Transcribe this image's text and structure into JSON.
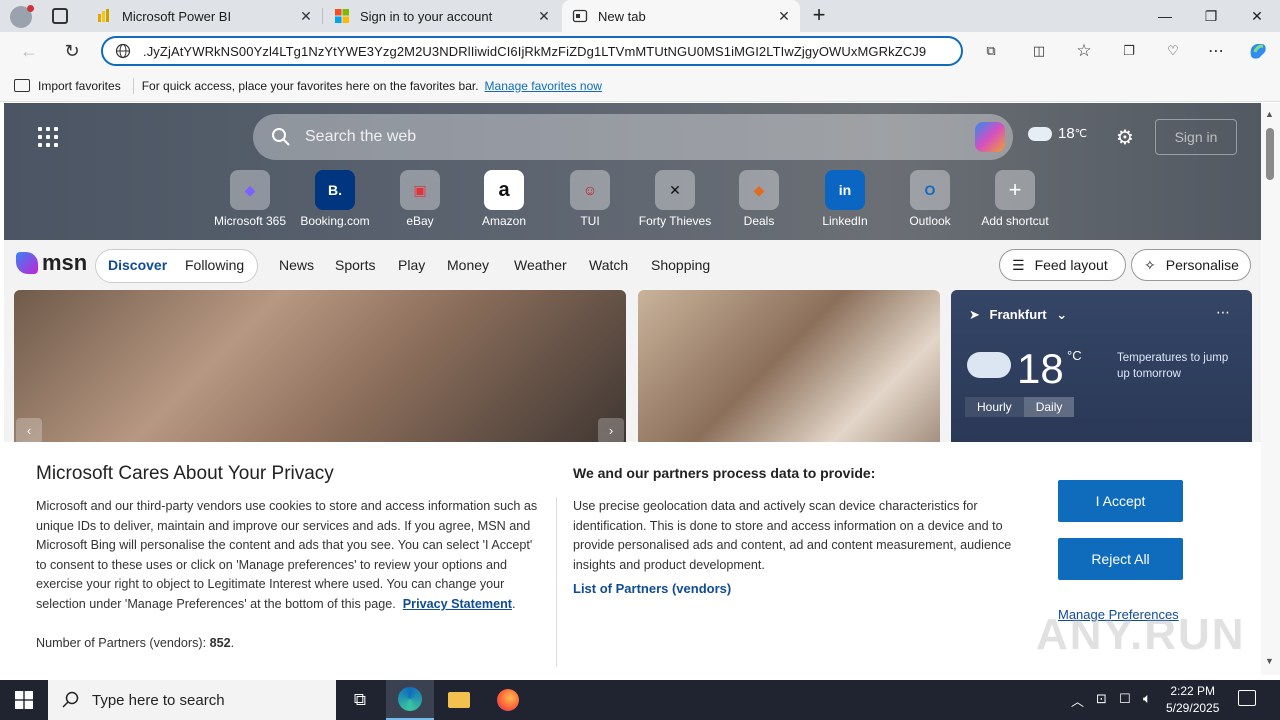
{
  "browser": {
    "tabs": [
      {
        "title": "Microsoft Power BI"
      },
      {
        "title": "Sign in to your account"
      },
      {
        "title": "New tab"
      }
    ],
    "address": ".JyZjAtYWRkNS00Yzl4LTg1NzYtYWE3Yzg2M2U3NDRlIiwidCI6IjRkMzFiZDg1LTVmMTUtNGU0MS1iMGI2LTIwZjgyOWUxMGRkZCJ9",
    "favorites_bar": {
      "import_label": "Import favorites",
      "message": "For quick access, place your favorites here on the favorites bar.",
      "manage_link": "Manage favorites now"
    }
  },
  "newtab": {
    "search_placeholder": "Search the web",
    "weather_temp": "18",
    "weather_unit": "℃",
    "signin_label": "Sign in",
    "shortcuts": [
      {
        "label": "Microsoft 365",
        "glyph": "◆"
      },
      {
        "label": "Booking.com",
        "glyph": "B."
      },
      {
        "label": "eBay",
        "glyph": "▣"
      },
      {
        "label": "Amazon",
        "glyph": "a"
      },
      {
        "label": "TUI",
        "glyph": "☺"
      },
      {
        "label": "Forty Thieves",
        "glyph": "✕"
      },
      {
        "label": "Deals",
        "glyph": "◆"
      },
      {
        "label": "LinkedIn",
        "glyph": "in"
      },
      {
        "label": "Outlook",
        "glyph": "O"
      },
      {
        "label": "Add shortcut",
        "glyph": "+"
      }
    ]
  },
  "msn": {
    "logo": "msn",
    "tabs": [
      "Discover",
      "Following"
    ],
    "nav": [
      "News",
      "Sports",
      "Play",
      "Money",
      "Weather",
      "Watch",
      "Shopping"
    ],
    "feed_layout": "Feed layout",
    "personalise": "Personalise",
    "weather_card": {
      "location": "Frankfurt",
      "temp": "18",
      "unit": "°C",
      "note": "Temperatures to jump up tomorrow",
      "toggle": [
        "Hourly",
        "Daily"
      ]
    }
  },
  "consent": {
    "title": "Microsoft Cares About Your Privacy",
    "body": "Microsoft and our third-party vendors use cookies to store and access information such as unique IDs to deliver, maintain and improve our services and ads. If you agree, MSN and Microsoft Bing will personalise the content and ads that you see. You can select 'I Accept' to consent to these uses or click on 'Manage preferences' to review your options and exercise your right to object to Legitimate Interest where used.  You can change your selection under 'Manage Preferences' at the bottom of this page.",
    "privacy_link": "Privacy Statement",
    "partners_label": "Number of Partners (vendors):",
    "partners_count": "852",
    "purpose_title": "We and our partners process data to provide:",
    "purpose_body": "Use precise geolocation data and actively scan device characteristics for identification. This is done to store and access information on a device and to provide personalised ads and content, ad and content measurement, audience insights and product development.",
    "list_partners": "List of Partners (vendors)",
    "accept": "I Accept",
    "reject": "Reject All",
    "manage": "Manage Preferences"
  },
  "taskbar": {
    "search_placeholder": "Type here to search",
    "time": "2:22 PM",
    "date": "5/29/2025"
  },
  "watermark": "ANY.RUN",
  "colors": {
    "accent": "#0f6cbd",
    "link": "#0f4c96",
    "taskbar": "#1f2430"
  }
}
